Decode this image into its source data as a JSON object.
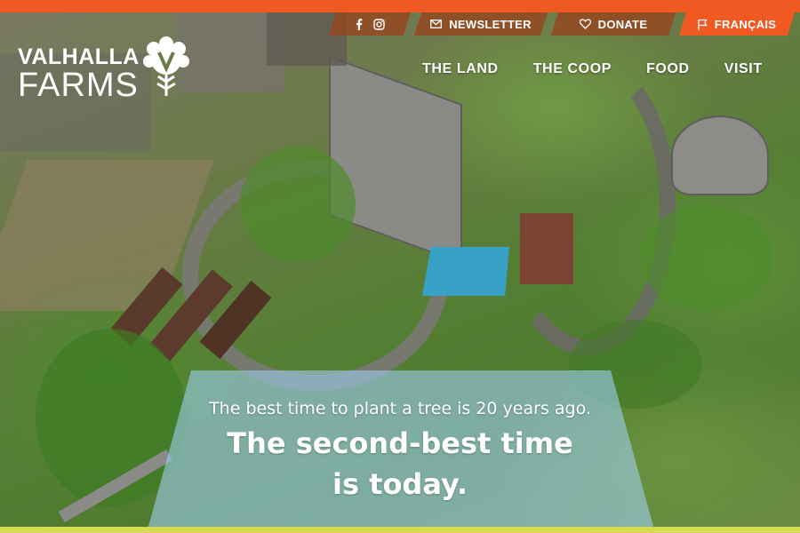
{
  "brand": {
    "name_line1": "VALHALLA",
    "name_line2": "FARMS",
    "logo_letter": "V"
  },
  "utility_nav": {
    "social_icons": [
      "facebook-icon",
      "instagram-icon"
    ],
    "newsletter": "NEWSLETTER",
    "donate": "DONATE",
    "language": "FRANÇAIS"
  },
  "main_nav": {
    "items": [
      "THE LAND",
      "THE COOP",
      "FOOD",
      "VISIT"
    ]
  },
  "hero": {
    "quote_line1": "The best time to plant a tree is 20 years ago.",
    "quote_line2": "The second-best time is today."
  },
  "colors": {
    "accent": "#f05a22",
    "accent_dark": "#96461e",
    "panel": "#9cccE9",
    "bottom_strip": "#d6dc52"
  }
}
